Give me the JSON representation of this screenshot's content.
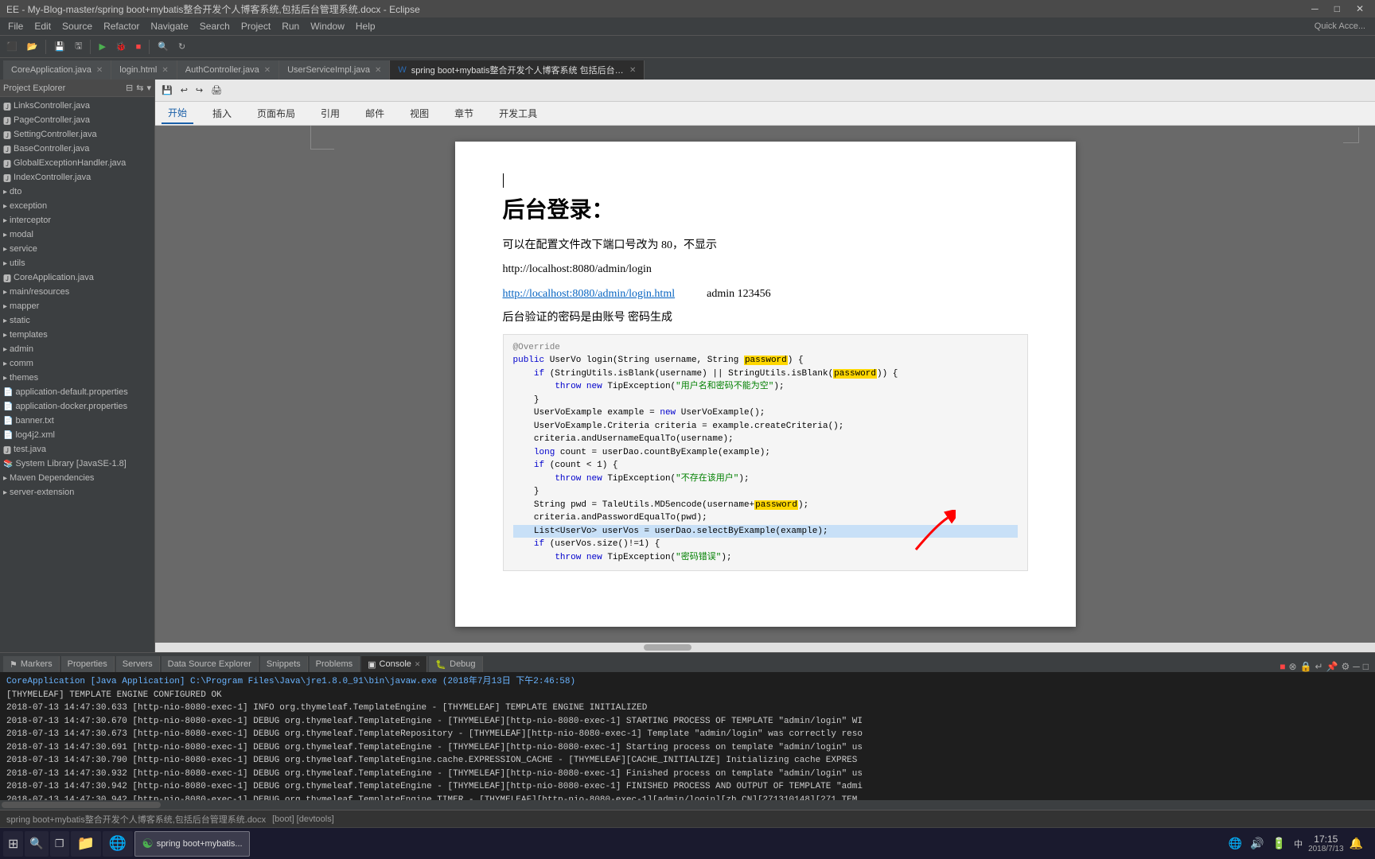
{
  "titlebar": {
    "title": "EE - My-Blog-master/spring boot+mybatis整合开发个人博客系统,包括后台管理系统.docx - Eclipse"
  },
  "toolbar": {
    "quickaccess_label": "Quick Acce..."
  },
  "tabs": [
    {
      "id": "tab1",
      "label": "CoreApplication.java",
      "active": false
    },
    {
      "id": "tab2",
      "label": "login.html",
      "active": false
    },
    {
      "id": "tab3",
      "label": "AuthController.java",
      "active": false
    },
    {
      "id": "tab4",
      "label": "UserServiceImpl.java",
      "active": false
    },
    {
      "id": "tab5",
      "label": "spring boot+mybatis整合开发个人博客系统 包括后台管理系统.docx",
      "active": true
    }
  ],
  "explorer": {
    "header": "Explorer",
    "items": [
      {
        "label": "LinksController.java",
        "indent": 0,
        "icon": "📄"
      },
      {
        "label": "PageController.java",
        "indent": 0,
        "icon": "📄"
      },
      {
        "label": "SettingController.java",
        "indent": 0,
        "icon": "📄"
      },
      {
        "label": "BaseController.java",
        "indent": 0,
        "icon": "📄"
      },
      {
        "label": "GlobalExceptionHandler.java",
        "indent": 0,
        "icon": "📄"
      },
      {
        "label": "IndexController.java",
        "indent": 0,
        "icon": "📄"
      },
      {
        "label": "dto",
        "indent": 0,
        "icon": "📁"
      },
      {
        "label": "exception",
        "indent": 0,
        "icon": "📁"
      },
      {
        "label": "interceptor",
        "indent": 0,
        "icon": "📁"
      },
      {
        "label": "modal",
        "indent": 0,
        "icon": "📁"
      },
      {
        "label": "service",
        "indent": 0,
        "icon": "📁"
      },
      {
        "label": "utils",
        "indent": 0,
        "icon": "📁"
      },
      {
        "label": "CoreApplication.java",
        "indent": 0,
        "icon": "📄"
      },
      {
        "label": "main/resources",
        "indent": 0,
        "icon": "📁"
      },
      {
        "label": "mapper",
        "indent": 0,
        "icon": "📁"
      },
      {
        "label": "static",
        "indent": 0,
        "icon": "📁"
      },
      {
        "label": "templates",
        "indent": 0,
        "icon": "📁"
      },
      {
        "label": "admin",
        "indent": 0,
        "icon": "📁"
      },
      {
        "label": "comm",
        "indent": 0,
        "icon": "📁"
      },
      {
        "label": "themes",
        "indent": 0,
        "icon": "📁"
      },
      {
        "label": "application-default.properties",
        "indent": 0,
        "icon": "📄"
      },
      {
        "label": "application-docker.properties",
        "indent": 0,
        "icon": "📄"
      },
      {
        "label": "banner.txt",
        "indent": 0,
        "icon": "📄"
      },
      {
        "label": "log4j2.xml",
        "indent": 0,
        "icon": "📄"
      },
      {
        "label": "test.java",
        "indent": 0,
        "icon": "📄"
      },
      {
        "label": "System Library [JavaSE-1.8]",
        "indent": 0,
        "icon": "📚"
      },
      {
        "label": "Maven Dependencies",
        "indent": 0,
        "icon": "📁"
      },
      {
        "label": "server-extension",
        "indent": 0,
        "icon": "📁"
      }
    ]
  },
  "doc": {
    "ribbon_tabs": [
      "开始",
      "插入",
      "页面布局",
      "引用",
      "邮件",
      "视图",
      "章节",
      "开发工具"
    ],
    "active_ribbon": "开始",
    "title": "后台登录：",
    "text1": "可以在配置文件改下端口号改为 80，不显示",
    "link1": "http://localhost:8080/admin/login",
    "link2": "http://localhost:8080/admin/login.html",
    "credentials": "admin    123456",
    "text2": "后台验证的密码是由账号 密码生成",
    "code": {
      "lines": [
        {
          "text": "@Override",
          "type": "annotation"
        },
        {
          "text": "public UserVo login(String username, String password) {",
          "type": "normal",
          "highlight": "password"
        },
        {
          "text": "    if (StringUtils.isBlank(username) || StringUtils.isBlank(password)) {",
          "type": "normal",
          "highlight2": "password"
        },
        {
          "text": "        throw new TipException(\"用户名和密码不能为空\");",
          "type": "string"
        },
        {
          "text": "    }",
          "type": "normal"
        },
        {
          "text": "    UserVoExample example = new UserVoExample();",
          "type": "normal"
        },
        {
          "text": "    UserVoExample.Criteria criteria = example.createCriteria();",
          "type": "normal"
        },
        {
          "text": "    criteria.andUsernameEqualTo(username);",
          "type": "normal"
        },
        {
          "text": "    long count = userDao.countByExample(example);",
          "type": "normal"
        },
        {
          "text": "    if (count < 1) {",
          "type": "normal"
        },
        {
          "text": "        throw new TipException(\"不存在该用户\");",
          "type": "string"
        },
        {
          "text": "    }",
          "type": "normal"
        },
        {
          "text": "    String pwd = TaleUtils.MD5encode(username+password);",
          "type": "normal",
          "highlight": "password"
        },
        {
          "text": "    criteria.andPasswordEqualTo(pwd);",
          "type": "normal"
        },
        {
          "text": "    List<UserVo> userVos = userDao.selectByExample(example);",
          "type": "selected"
        },
        {
          "text": "    if (userVos.size()!=1) {",
          "type": "normal"
        },
        {
          "text": "        throw new TipException(\"密码错误\");",
          "type": "partial"
        }
      ]
    }
  },
  "console": {
    "header": "CoreApplication [Java Application] C:\\Program Files\\Java\\jre1.8.0_91\\bin\\javaw.exe (2018年7月13日 下午2:46:58)",
    "lines": [
      "[THYMELEAF] TEMPLATE ENGINE CONFIGURED OK",
      "2018-07-13  14:47:30.633  [http-nio-8080-exec-1]  INFO   org.thymeleaf.TemplateEngine - [THYMELEAF] TEMPLATE ENGINE INITIALIZED",
      "2018-07-13  14:47:30.670  [http-nio-8080-exec-1]  DEBUG  org.thymeleaf.TemplateEngine - [THYMELEAF][http-nio-8080-exec-1] STARTING PROCESS OF TEMPLATE \"admin/login\" WI",
      "2018-07-13  14:47:30.673  [http-nio-8080-exec-1]  DEBUG  org.thymeleaf.TemplateRepository - [THYMELEAF][http-nio-8080-exec-1] Template \"admin/login\" was correctly reso",
      "2018-07-13  14:47:30.691  [http-nio-8080-exec-1]  DEBUG  org.thymeleaf.TemplateEngine - [THYMELEAF][http-nio-8080-exec-1] Starting process on template \"admin/login\" us",
      "2018-07-13  14:47:30.790  [http-nio-8080-exec-1]  DEBUG  org.thymeleaf.TemplateEngine.cache.EXPRESSION_CACHE - [THYMELEAF][CACHE_INITIALIZE] Initializing cache EXPRES",
      "2018-07-13  14:47:30.932  [http-nio-8080-exec-1]  DEBUG  org.thymeleaf.TemplateEngine - [THYMELEAF][http-nio-8080-exec-1] Finished process on template \"admin/login\" us",
      "2018-07-13  14:47:30.942  [http-nio-8080-exec-1]  DEBUG  org.thymeleaf.TemplateEngine - [THYMELEAF][http-nio-8080-exec-1] FINISHED PROCESS AND OUTPUT OF TEMPLATE \"admi",
      "2018-07-13  14:47:30.942  [http-nio-8080-exec-1]  DEBUG  org.thymeleaf.TemplateEngine.TIMER - [THYMELEAF][http-nio-8080-exec-1][admin/login][zh_CN][271310148][271  TEM"
    ]
  },
  "bottom_tabs": [
    {
      "label": "Markers",
      "active": false
    },
    {
      "label": "Properties",
      "active": false
    },
    {
      "label": "Servers",
      "active": false
    },
    {
      "label": "Data Source Explorer",
      "active": false
    },
    {
      "label": "Snippets",
      "active": false
    },
    {
      "label": "Problems",
      "active": false
    },
    {
      "label": "Console",
      "active": true
    },
    {
      "label": "Debug",
      "active": false
    }
  ],
  "statusbar": {
    "items": [
      "spring boot+mybatis整合开发个人博客系统,包括后台管理系统.docx",
      "[boot] [devtools]"
    ]
  },
  "taskbar": {
    "time": "17:15",
    "date": "2018/7/13",
    "apps": [
      {
        "label": "⊞",
        "icon": "start"
      },
      {
        "label": "🔍",
        "icon": "search"
      }
    ]
  }
}
